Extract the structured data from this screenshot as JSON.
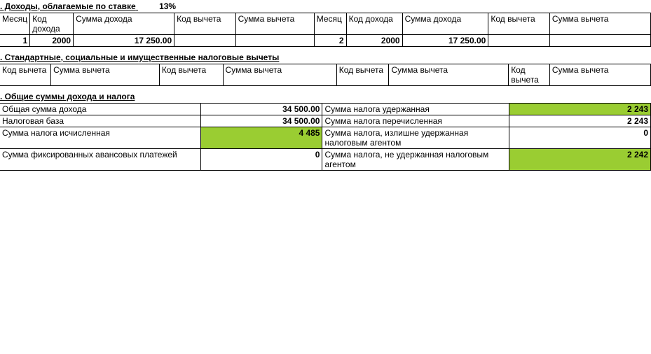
{
  "section3": {
    "title": ". Доходы, облагаемые по ставке",
    "rate": "13%",
    "headers": {
      "month": "Месяц",
      "income_code": "Код дохода",
      "income_sum": "Сумма дохода",
      "deduction_code": "Код вычета",
      "deduction_sum": "Сумма вычета"
    },
    "row1": {
      "month_a": "1",
      "code_a": "2000",
      "sum_a": "17 250.00",
      "ded_code_a": "",
      "ded_sum_a": "",
      "month_b": "2",
      "code_b": "2000",
      "sum_b": "17 250.00",
      "ded_code_b": "",
      "ded_sum_b": ""
    }
  },
  "section4": {
    "title": ". Стандартные, социальные и имущественные налоговые вычеты",
    "headers": {
      "code": "Код вычета",
      "sum": "Сумма вычета"
    }
  },
  "section5": {
    "title": ". Общие суммы дохода и налога",
    "rows": {
      "total_income_label": "Общая сумма дохода",
      "total_income_value": "34 500.00",
      "tax_withheld_label": "Сумма налога удержанная",
      "tax_withheld_value": "2 243",
      "tax_base_label": "Налоговая база",
      "tax_base_value": "34 500.00",
      "tax_transferred_label": "Сумма налога перечисленная",
      "tax_transferred_value": "2 243",
      "tax_calc_label": "Сумма налога исчисленная",
      "tax_calc_value": "4 485",
      "tax_over_label": "Сумма налога, излишне удержанная налоговым агентом",
      "tax_over_value": "0",
      "fixed_adv_label": "Сумма фиксированных авансовых платежей",
      "fixed_adv_value": "0",
      "tax_not_withheld_label": "Сумма налога, не удержанная налоговым агентом",
      "tax_not_withheld_value": "2 242"
    }
  }
}
